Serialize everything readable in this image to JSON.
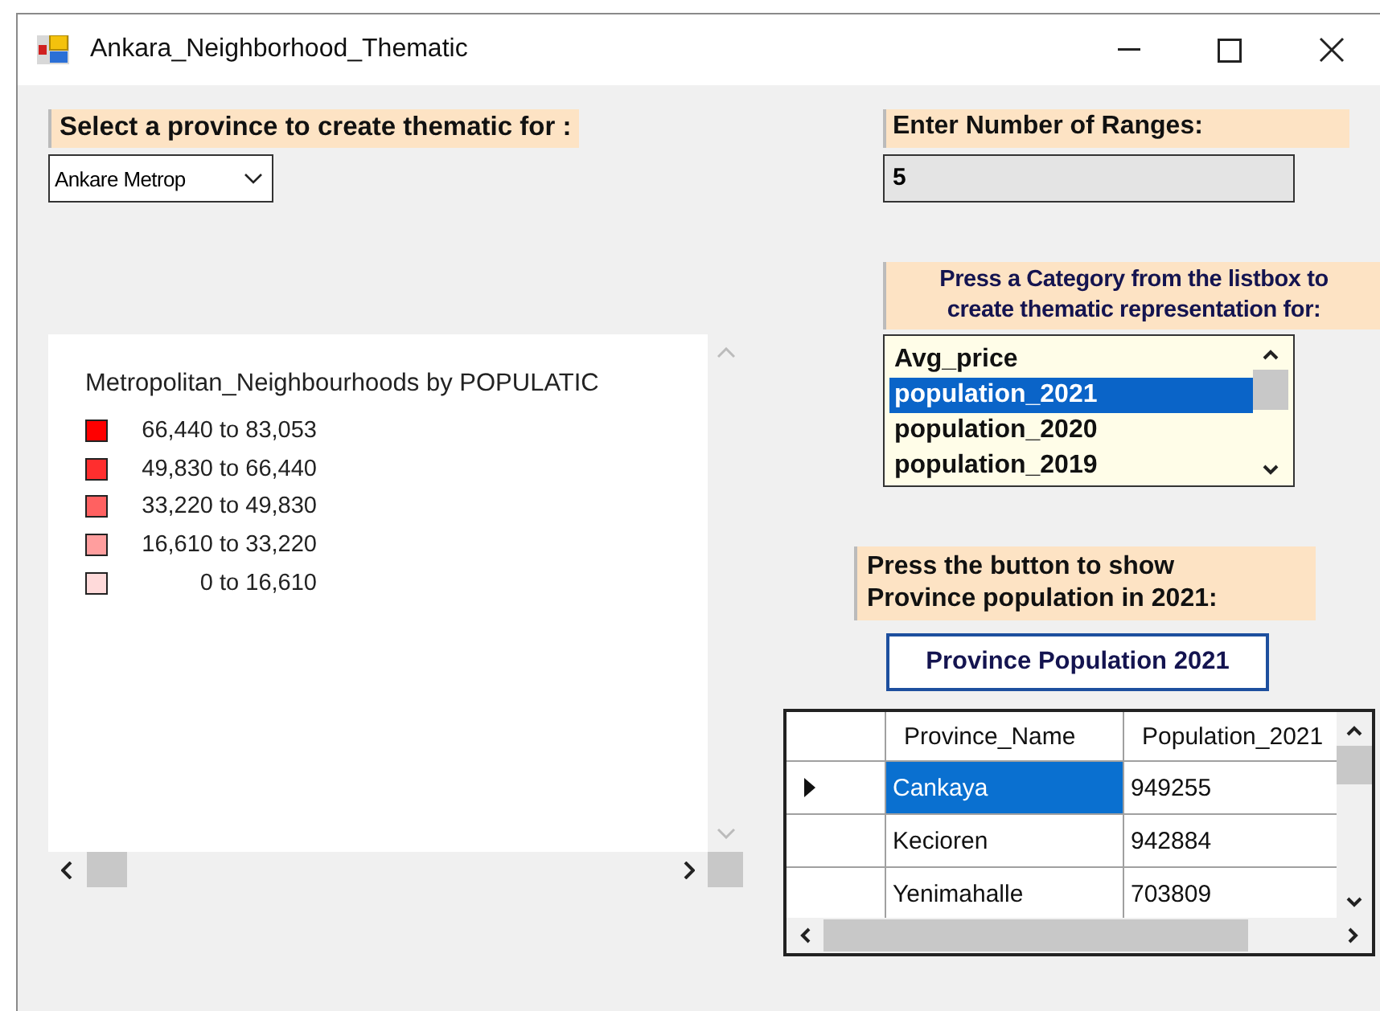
{
  "window": {
    "title": "Ankara_Neighborhood_Thematic"
  },
  "province_label": "Select a province to create thematic for :",
  "province_combo": {
    "value": "Ankare Metrop"
  },
  "legend": {
    "title": "Metropolitan_Neighbourhoods by POPULATIC",
    "items": [
      {
        "label": "66,440 to 83,053",
        "color": "#ff0000"
      },
      {
        "label": "49,830 to 66,440",
        "color": "#ff2e2e"
      },
      {
        "label": "33,220 to 49,830",
        "color": "#ff6161"
      },
      {
        "label": "16,610 to 33,220",
        "color": "#ff9e9e"
      },
      {
        "label": "0 to 16,610",
        "color": "#ffdada"
      }
    ]
  },
  "ranges_label": "Enter Number of Ranges:",
  "ranges_field": {
    "value": "5"
  },
  "category_label": {
    "lines": [
      "Press a Category from the listbox to",
      "create thematic representation for:"
    ]
  },
  "category_list": {
    "items": [
      {
        "label": "Avg_price",
        "selected": false
      },
      {
        "label": "population_2021",
        "selected": true
      },
      {
        "label": "population_2020",
        "selected": false
      },
      {
        "label": "population_2019",
        "selected": false
      }
    ]
  },
  "population_label": {
    "lines": [
      "Press the button to show",
      "Province population in 2021:"
    ]
  },
  "population_button": "Province Population 2021",
  "grid": {
    "columns": [
      "Province_Name",
      "Population_2021"
    ],
    "rows": [
      {
        "cells": [
          "Cankaya",
          "949255"
        ],
        "selected": true
      },
      {
        "cells": [
          "Kecioren",
          "942884"
        ],
        "selected": false
      },
      {
        "cells": [
          "Yenimahalle",
          "703809"
        ],
        "selected": false
      }
    ]
  }
}
